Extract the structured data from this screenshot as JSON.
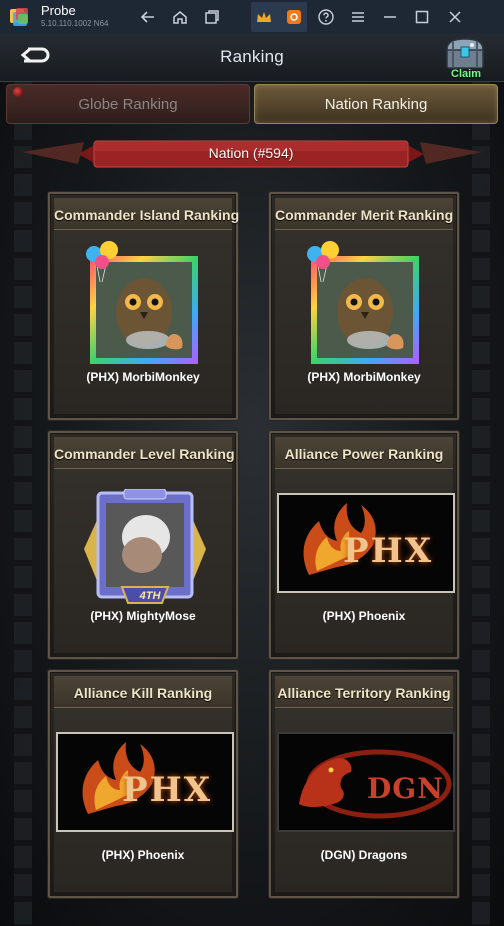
{
  "emulator": {
    "title": "Probe",
    "version": "5.10.110.1002 N64",
    "icons": [
      "back-arrow-icon",
      "home-icon",
      "multi-window-icon",
      "crown-icon",
      "gear-badge-icon",
      "help-icon",
      "menu-icon",
      "minimize-icon",
      "maximize-icon",
      "close-icon"
    ]
  },
  "header": {
    "title": "Ranking",
    "claim_label": "Claim"
  },
  "tabs": [
    {
      "label": "Globe Ranking",
      "active": false
    },
    {
      "label": "Nation Ranking",
      "active": true
    }
  ],
  "banner": {
    "label": "Nation (#594)"
  },
  "cards": [
    {
      "title": "Commander Island Ranking",
      "name": "(PHX) MorbiMonkey",
      "image": "owl-portrait"
    },
    {
      "title": "Commander Merit Ranking",
      "name": "(PHX) MorbiMonkey",
      "image": "owl-portrait"
    },
    {
      "title": "Commander Level Ranking",
      "name": "(PHX) MightyMose",
      "image": "level-portrait",
      "badge": "4TH"
    },
    {
      "title": "Alliance Power Ranking",
      "name": "(PHX) Phoenix",
      "image": "phoenix-flag",
      "flag_text": "PHX"
    },
    {
      "title": "Alliance Kill Ranking",
      "name": "(PHX) Phoenix",
      "image": "phoenix-flag",
      "flag_text": "PHX"
    },
    {
      "title": "Alliance Territory Ranking",
      "name": "(DGN) Dragons",
      "image": "dragon-flag",
      "flag_text": "DGN"
    }
  ],
  "colors": {
    "claim_green": "#7cf58a",
    "banner_red": "#8e1c1c",
    "card_border": "#5e5548"
  }
}
